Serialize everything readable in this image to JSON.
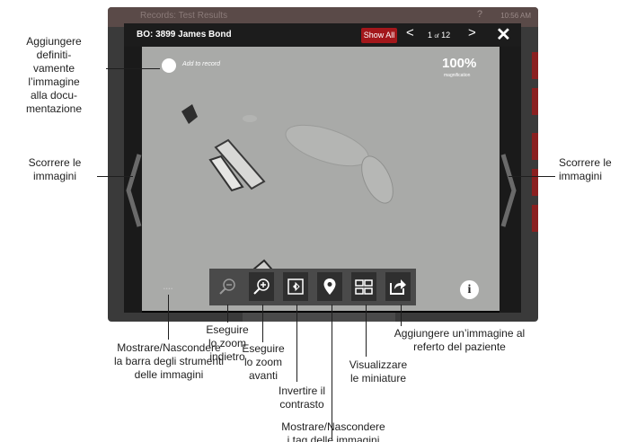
{
  "background_app": {
    "title": "Records: Test Results",
    "help": "?",
    "time": "10:56 AM"
  },
  "viewer": {
    "patient_label": "BO: 3899 James Bond",
    "show_all_label": "Show All",
    "prev_label": "<",
    "next_label": ">",
    "page_current": "1",
    "page_of": "of",
    "page_total": "12",
    "close_label": "✕",
    "add_to_record_label": "Add to record",
    "magnification_value": "100%",
    "magnification_label": "magnification",
    "info_label": "i",
    "toolbar_handle": "••••"
  },
  "toolbar": {
    "tools": [
      {
        "name": "zoom-out",
        "icon": "zoom-out-icon"
      },
      {
        "name": "zoom-in",
        "icon": "zoom-in-icon"
      },
      {
        "name": "invert-contrast",
        "icon": "contrast-icon"
      },
      {
        "name": "image-tags",
        "icon": "location-pin-icon"
      },
      {
        "name": "thumbnails",
        "icon": "grid-icon"
      },
      {
        "name": "add-to-report",
        "icon": "share-icon"
      }
    ]
  },
  "callouts": {
    "add_image_l1": "Aggiungere",
    "add_image_l2": "definiti-",
    "add_image_l3": "vamente",
    "add_image_l4": "l’immagine",
    "add_image_l5": "alla docu-",
    "add_image_l6": "mentazione",
    "scroll_left_l1": "Scorrere le",
    "scroll_left_l2": "immagini",
    "scroll_right_l1": "Scorrere le",
    "scroll_right_l2": "immagini",
    "toolbar_l1": "Mostrare/Nascondere",
    "toolbar_l2": "la barra degli strumenti",
    "toolbar_l3": "delle immagini",
    "zoom_out_l1": "Eseguire",
    "zoom_out_l2": "lo zoom",
    "zoom_out_l3": "indietro",
    "zoom_in_l1": "Eseguire",
    "zoom_in_l2": "lo zoom",
    "zoom_in_l3": "avanti",
    "invert_l1": "Invertire il",
    "invert_l2": "contrasto",
    "tags_l1": "Mostrare/Nascondere",
    "tags_l2": "i tag delle immagini",
    "thumbs_l1": "Visualizzare",
    "thumbs_l2": "le miniature",
    "report_l1": "Aggiungere un’immagine al",
    "report_l2": "referto del paziente"
  },
  "colors": {
    "accent": "#a3171b",
    "toolbar": "#4a4a4a",
    "image_background": "#a9aaa8"
  }
}
